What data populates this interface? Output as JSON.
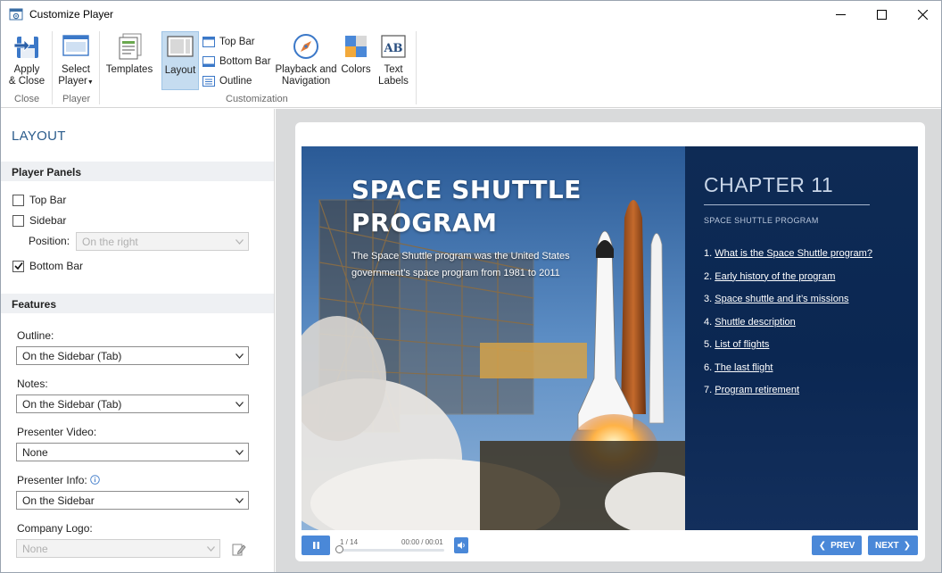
{
  "window": {
    "title": "Customize Player"
  },
  "ribbon": {
    "apply_close_label_1": "Apply",
    "apply_close_label_2": "& Close",
    "select_player_label_1": "Select",
    "select_player_label_2": "Player",
    "templates_label": "Templates",
    "layout_label": "Layout",
    "top_bar_label": "Top Bar",
    "bottom_bar_label": "Bottom Bar",
    "outline_label": "Outline",
    "playback_label_1": "Playback and",
    "playback_label_2": "Navigation",
    "colors_label": "Colors",
    "text_labels_label_1": "Text",
    "text_labels_label_2": "Labels",
    "groups": {
      "close": "Close",
      "player": "Player",
      "customization": "Customization"
    }
  },
  "panel": {
    "title": "LAYOUT",
    "player_panels_header": "Player Panels",
    "top_bar": {
      "label": "Top Bar",
      "checked": false
    },
    "sidebar": {
      "label": "Sidebar",
      "checked": false
    },
    "position_label": "Position:",
    "position_value": "On the right",
    "bottom_bar": {
      "label": "Bottom Bar",
      "checked": true
    },
    "features_header": "Features",
    "outline_label": "Outline:",
    "outline_value": "On the Sidebar (Tab)",
    "notes_label": "Notes:",
    "notes_value": "On the Sidebar (Tab)",
    "presenter_video_label": "Presenter Video:",
    "presenter_video_value": "None",
    "presenter_info_label": "Presenter Info:",
    "presenter_info_value": "On the Sidebar",
    "company_logo_label": "Company Logo:",
    "company_logo_value": "None"
  },
  "slide": {
    "title_line1": "SPACE SHUTTLE",
    "title_line2": "PROGRAM",
    "description": "The Space Shuttle program was the United States government’s space program from 1981 to 2011",
    "chapter_title": "CHAPTER 11",
    "chapter_subtitle": "SPACE SHUTTLE PROGRAM",
    "toc": [
      {
        "num": "1.",
        "text": "What is the Space Shuttle program?"
      },
      {
        "num": "2.",
        "text": "Early history of the program"
      },
      {
        "num": "3.",
        "text": "Space shuttle and it’s missions"
      },
      {
        "num": "4.",
        "text": "Shuttle description"
      },
      {
        "num": "5.",
        "text": "List of flights"
      },
      {
        "num": "6.",
        "text": "The last flight"
      },
      {
        "num": "7.",
        "text": "Program retirement"
      }
    ]
  },
  "player": {
    "slide_counter": "1 / 14",
    "time": "00:00 / 00:01",
    "prev_label": "PREV",
    "next_label": "NEXT",
    "pause_icon": "pause-icon",
    "volume_icon": "volume-icon"
  },
  "colors": {
    "accent": "#4a88d8",
    "panel_title": "#2b5c8c",
    "chapter_bg": "#0e2b55"
  }
}
